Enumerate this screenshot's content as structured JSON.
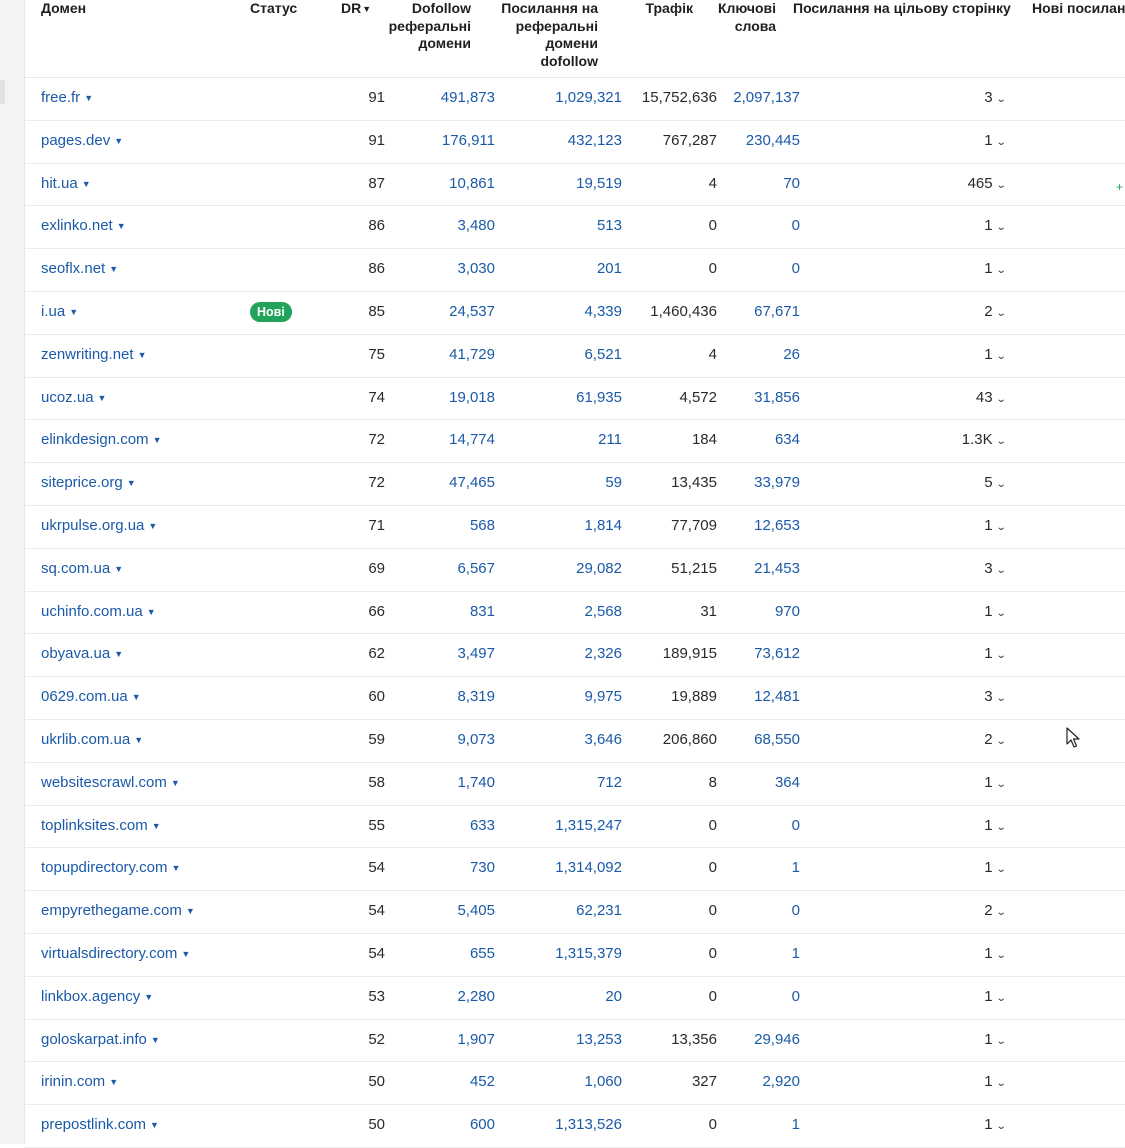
{
  "columns": {
    "domain": "Домен",
    "status": "Статус",
    "dr": "DR",
    "dofollow_ref_domains": [
      "Dofollow",
      "реферальні",
      "домени"
    ],
    "links_to_ref_domains": [
      "Посилання на",
      "реферальні",
      "домени",
      "dofollow"
    ],
    "traffic": "Трафік",
    "keywords": [
      "Ключові",
      "слова"
    ],
    "links_to_target": "Посилання на цільову сторінку",
    "new_links": "Нові посилан"
  },
  "icons": {
    "sort": "sort-desc-icon",
    "domain_dropdown": "caret-down-icon",
    "expand": "chevron-down-icon"
  },
  "colors": {
    "link": "#1b5aa8",
    "badge_new": "#22a35a"
  },
  "rows": [
    {
      "domain": "free.fr",
      "status": "",
      "dr": "91",
      "dofollow_ref_domains": "491,873",
      "links_dofollow": "1,029,321",
      "traffic": "15,752,636",
      "keywords": "2,097,137",
      "target_links": "3"
    },
    {
      "domain": "pages.dev",
      "status": "",
      "dr": "91",
      "dofollow_ref_domains": "176,911",
      "links_dofollow": "432,123",
      "traffic": "767,287",
      "keywords": "230,445",
      "target_links": "1"
    },
    {
      "domain": "hit.ua",
      "status": "",
      "dr": "87",
      "dofollow_ref_domains": "10,861",
      "links_dofollow": "19,519",
      "traffic": "4",
      "keywords": "70",
      "target_links": "465"
    },
    {
      "domain": "exlinko.net",
      "status": "",
      "dr": "86",
      "dofollow_ref_domains": "3,480",
      "links_dofollow": "513",
      "traffic": "0",
      "keywords": "0",
      "target_links": "1"
    },
    {
      "domain": "seoflx.net",
      "status": "",
      "dr": "86",
      "dofollow_ref_domains": "3,030",
      "links_dofollow": "201",
      "traffic": "0",
      "keywords": "0",
      "target_links": "1"
    },
    {
      "domain": "i.ua",
      "status": "Нові",
      "dr": "85",
      "dofollow_ref_domains": "24,537",
      "links_dofollow": "4,339",
      "traffic": "1,460,436",
      "keywords": "67,671",
      "target_links": "2"
    },
    {
      "domain": "zenwriting.net",
      "status": "",
      "dr": "75",
      "dofollow_ref_domains": "41,729",
      "links_dofollow": "6,521",
      "traffic": "4",
      "keywords": "26",
      "target_links": "1"
    },
    {
      "domain": "ucoz.ua",
      "status": "",
      "dr": "74",
      "dofollow_ref_domains": "19,018",
      "links_dofollow": "61,935",
      "traffic": "4,572",
      "keywords": "31,856",
      "target_links": "43"
    },
    {
      "domain": "elinkdesign.com",
      "status": "",
      "dr": "72",
      "dofollow_ref_domains": "14,774",
      "links_dofollow": "211",
      "traffic": "184",
      "keywords": "634",
      "target_links": "1.3K"
    },
    {
      "domain": "siteprice.org",
      "status": "",
      "dr": "72",
      "dofollow_ref_domains": "47,465",
      "links_dofollow": "59",
      "traffic": "13,435",
      "keywords": "33,979",
      "target_links": "5"
    },
    {
      "domain": "ukrpulse.org.ua",
      "status": "",
      "dr": "71",
      "dofollow_ref_domains": "568",
      "links_dofollow": "1,814",
      "traffic": "77,709",
      "keywords": "12,653",
      "target_links": "1"
    },
    {
      "domain": "sq.com.ua",
      "status": "",
      "dr": "69",
      "dofollow_ref_domains": "6,567",
      "links_dofollow": "29,082",
      "traffic": "51,215",
      "keywords": "21,453",
      "target_links": "3"
    },
    {
      "domain": "uchinfo.com.ua",
      "status": "",
      "dr": "66",
      "dofollow_ref_domains": "831",
      "links_dofollow": "2,568",
      "traffic": "31",
      "keywords": "970",
      "target_links": "1"
    },
    {
      "domain": "obyava.ua",
      "status": "",
      "dr": "62",
      "dofollow_ref_domains": "3,497",
      "links_dofollow": "2,326",
      "traffic": "189,915",
      "keywords": "73,612",
      "target_links": "1"
    },
    {
      "domain": "0629.com.ua",
      "status": "",
      "dr": "60",
      "dofollow_ref_domains": "8,319",
      "links_dofollow": "9,975",
      "traffic": "19,889",
      "keywords": "12,481",
      "target_links": "3"
    },
    {
      "domain": "ukrlib.com.ua",
      "status": "",
      "dr": "59",
      "dofollow_ref_domains": "9,073",
      "links_dofollow": "3,646",
      "traffic": "206,860",
      "keywords": "68,550",
      "target_links": "2"
    },
    {
      "domain": "websitescrawl.com",
      "status": "",
      "dr": "58",
      "dofollow_ref_domains": "1,740",
      "links_dofollow": "712",
      "traffic": "8",
      "keywords": "364",
      "target_links": "1"
    },
    {
      "domain": "toplinksites.com",
      "status": "",
      "dr": "55",
      "dofollow_ref_domains": "633",
      "links_dofollow": "1,315,247",
      "traffic": "0",
      "keywords": "0",
      "target_links": "1"
    },
    {
      "domain": "topupdirectory.com",
      "status": "",
      "dr": "54",
      "dofollow_ref_domains": "730",
      "links_dofollow": "1,314,092",
      "traffic": "0",
      "keywords": "1",
      "target_links": "1"
    },
    {
      "domain": "empyrethegame.com",
      "status": "",
      "dr": "54",
      "dofollow_ref_domains": "5,405",
      "links_dofollow": "62,231",
      "traffic": "0",
      "keywords": "0",
      "target_links": "2"
    },
    {
      "domain": "virtualsdirectory.com",
      "status": "",
      "dr": "54",
      "dofollow_ref_domains": "655",
      "links_dofollow": "1,315,379",
      "traffic": "0",
      "keywords": "1",
      "target_links": "1"
    },
    {
      "domain": "linkbox.agency",
      "status": "",
      "dr": "53",
      "dofollow_ref_domains": "2,280",
      "links_dofollow": "20",
      "traffic": "0",
      "keywords": "0",
      "target_links": "1"
    },
    {
      "domain": "goloskarpat.info",
      "status": "",
      "dr": "52",
      "dofollow_ref_domains": "1,907",
      "links_dofollow": "13,253",
      "traffic": "13,356",
      "keywords": "29,946",
      "target_links": "1"
    },
    {
      "domain": "irinin.com",
      "status": "",
      "dr": "50",
      "dofollow_ref_domains": "452",
      "links_dofollow": "1,060",
      "traffic": "327",
      "keywords": "2,920",
      "target_links": "1"
    },
    {
      "domain": "prepostlink.com",
      "status": "",
      "dr": "50",
      "dofollow_ref_domains": "600",
      "links_dofollow": "1,313,526",
      "traffic": "0",
      "keywords": "1",
      "target_links": "1"
    }
  ],
  "side_marks": {
    "plus": "+"
  }
}
